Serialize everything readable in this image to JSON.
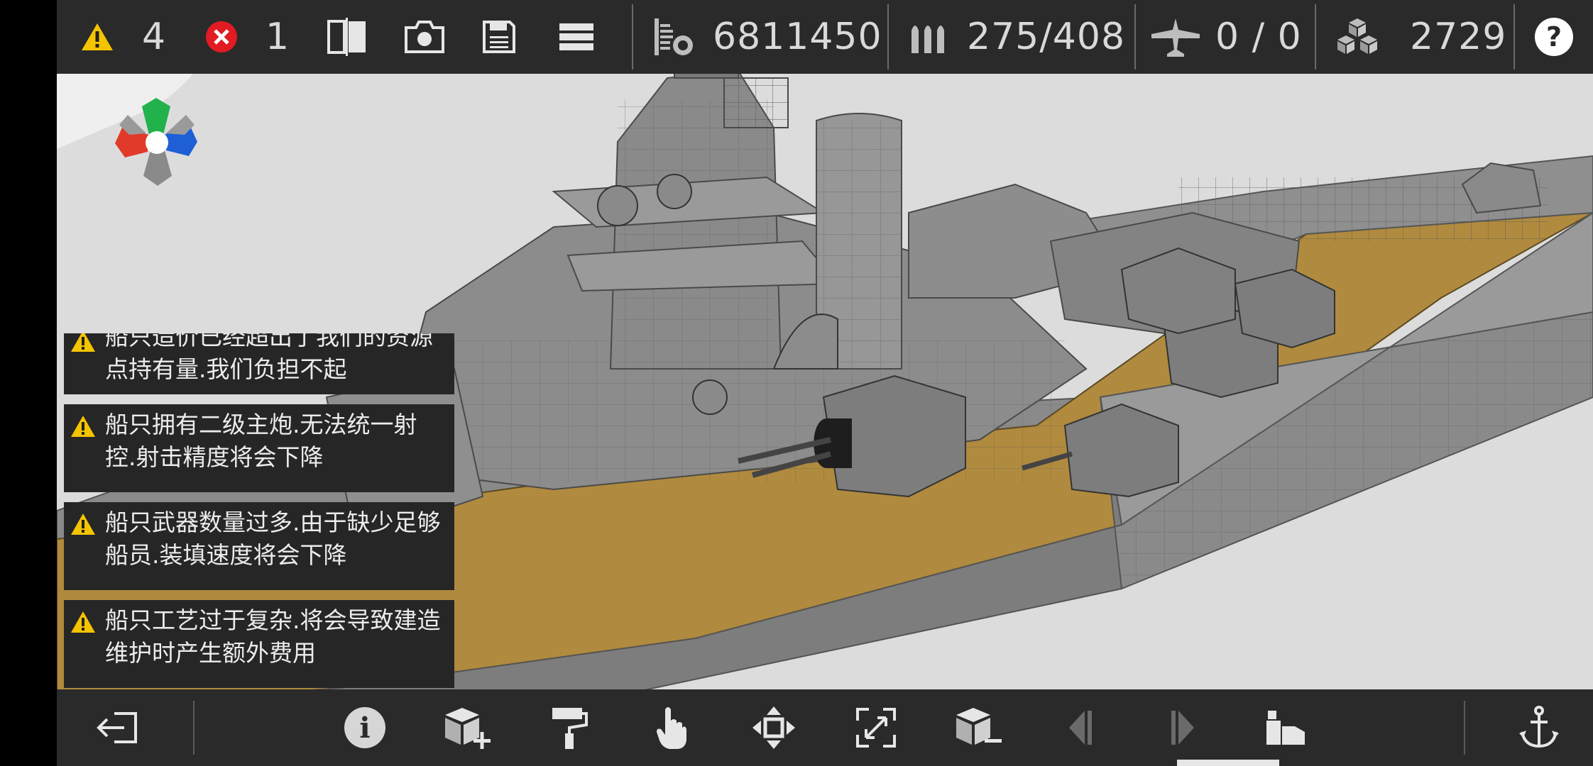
{
  "topbar": {
    "warning_count": "4",
    "error_count": "1",
    "cost": "6811450",
    "ammo": "275/408",
    "aircraft": "0 / 0",
    "resources": "2729",
    "help_label": "?"
  },
  "warnings": [
    {
      "text": "船只造价已经超出了我们的资源点持有量.我们负担不起"
    },
    {
      "text": "船只拥有二级主炮.无法统一射控.射击精度将会下降"
    },
    {
      "text": "船只武器数量过多.由于缺少足够船员.装填速度将会下降"
    },
    {
      "text": "船只工艺过于复杂.将会导致建造维护时产生额外费用"
    }
  ],
  "bottombar": {
    "info_label": "i"
  },
  "colors": {
    "bar_bg": "#2a2a2a",
    "icon_fg": "#e6e6e6",
    "warning_yellow": "#f5c400",
    "error_red": "#e21b23",
    "deck_tan": "#b08a3e",
    "hull_gray": "#7d7d7d",
    "viewport_bg": "#dcdcdc"
  },
  "icons": [
    "warning-icon",
    "error-icon",
    "split-view-icon",
    "camera-icon",
    "save-icon",
    "menu-icon",
    "cost-icon",
    "ammo-icon",
    "aircraft-icon",
    "resources-icon",
    "help-icon",
    "exit-icon",
    "info-icon",
    "add-part-icon",
    "paint-roller-icon",
    "touch-icon",
    "move-icon",
    "scale-icon",
    "remove-part-icon",
    "prev-icon",
    "next-icon",
    "ship-parts-icon",
    "anchor-icon",
    "axis-gizmo-icon"
  ]
}
